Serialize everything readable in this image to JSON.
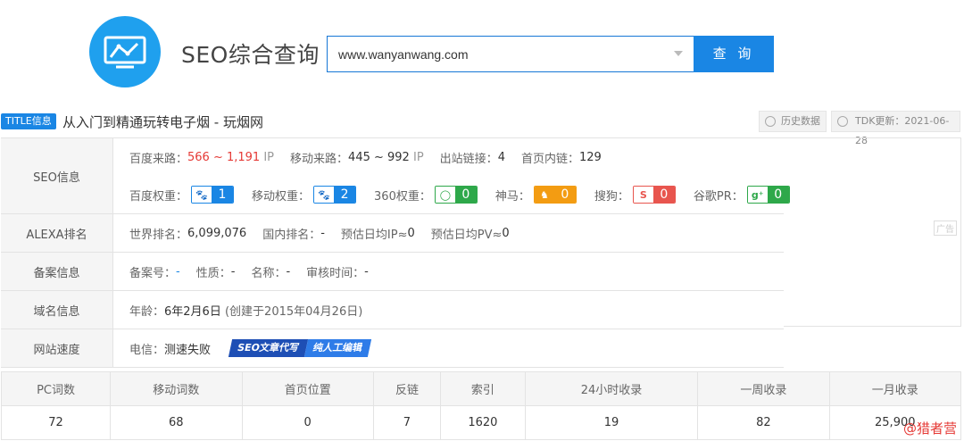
{
  "header": {
    "title": "SEO综合查询",
    "search_value": "www.wanyanwang.com",
    "search_button": "查 询",
    "logo_icon": "monitor-chart-icon"
  },
  "title_bar": {
    "tag": "TITLE信息",
    "text": "从入门到精通玩转电子烟 - 玩烟网",
    "history_button": "历史数据",
    "tdk_update": "TDK更新：2021-06-28"
  },
  "seo_info": {
    "label": "SEO信息",
    "baidu_traffic_label": "百度来路：",
    "baidu_traffic_value": "566 ~ 1,191",
    "baidu_traffic_unit": "IP",
    "mobile_traffic_label": "移动来路：",
    "mobile_traffic_value": "445 ~ 992",
    "mobile_traffic_unit": "IP",
    "outlinks_label": "出站链接：",
    "outlinks_value": "4",
    "homepage_inlinks_label": "首页内链：",
    "homepage_inlinks_value": "129",
    "baidu_weight_label": "百度权重：",
    "baidu_weight_value": "1",
    "mobile_weight_label": "移动权重：",
    "mobile_weight_value": "2",
    "w360_label": "360权重：",
    "w360_value": "0",
    "shenma_label": "神马：",
    "shenma_value": "0",
    "sogou_label": "搜狗：",
    "sogou_value": "0",
    "google_pr_label": "谷歌PR：",
    "google_pr_value": "0"
  },
  "alexa": {
    "label": "ALEXA排名",
    "world_rank_label": "世界排名：",
    "world_rank_value": "6,099,076",
    "domestic_rank_label": "国内排名：",
    "domestic_rank_value": "-",
    "daily_ip_label": "预估日均IP≈",
    "daily_ip_value": "0",
    "daily_pv_label": "预估日均PV≈",
    "daily_pv_value": "0"
  },
  "icp": {
    "label": "备案信息",
    "number_label": "备案号：",
    "number_value": "-",
    "nature_label": "性质：",
    "nature_value": "-",
    "name_label": "名称：",
    "name_value": "-",
    "audit_label": "审核时间：",
    "audit_value": "-"
  },
  "domain": {
    "label": "域名信息",
    "age_label": "年龄：",
    "age_value": "6年2月6日",
    "created": "(创建于2015年04月26日)"
  },
  "speed": {
    "label": "网站速度",
    "telecom_label": "电信：",
    "telecom_value": "测速失败",
    "banner_left": "SEO文章代写",
    "banner_right": "纯人工编辑"
  },
  "ad_tag": "广告",
  "stats": {
    "headers": [
      "PC词数",
      "移动词数",
      "首页位置",
      "反链",
      "索引",
      "24小时收录",
      "一周收录",
      "一月收录"
    ],
    "values": [
      "72",
      "68",
      "0",
      "7",
      "1620",
      "19",
      "82",
      "25,900"
    ]
  },
  "watermark": "@猎者营",
  "colors": {
    "accent": "#1a86e4",
    "red": "#e53935",
    "green": "#2ea84a",
    "orange": "#f39c12"
  }
}
